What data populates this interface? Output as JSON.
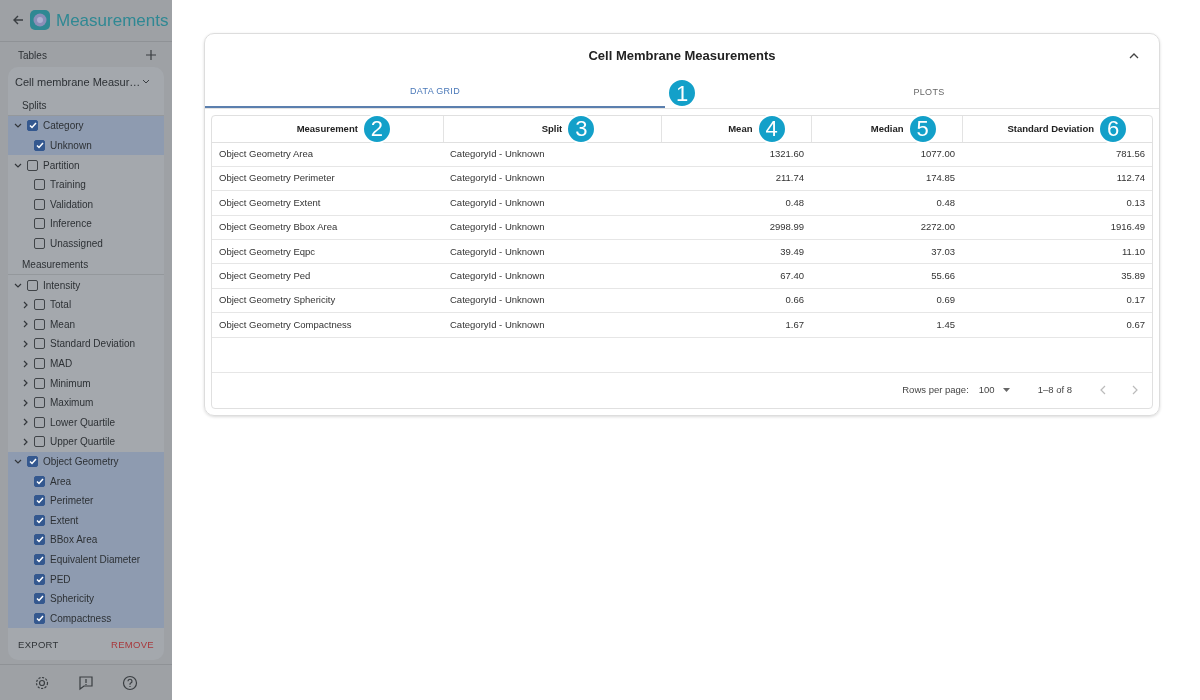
{
  "sidebar": {
    "title": "Measurements",
    "tables_label": "Tables",
    "table_select": "Cell membrane Measur…",
    "sections": [
      {
        "heading": "Splits",
        "items": [
          {
            "label": "Category",
            "checked": true,
            "expanded": true,
            "children": [
              {
                "label": "Unknown",
                "checked": true
              }
            ]
          },
          {
            "label": "Partition",
            "checked": false,
            "expanded": true,
            "children": [
              {
                "label": "Training",
                "checked": false
              },
              {
                "label": "Validation",
                "checked": false
              },
              {
                "label": "Inference",
                "checked": false
              },
              {
                "label": "Unassigned",
                "checked": false
              }
            ]
          }
        ]
      },
      {
        "heading": "Measurements",
        "items": [
          {
            "label": "Intensity",
            "checked": false,
            "expanded": true,
            "children": [
              {
                "label": "Total",
                "checked": false,
                "expanded": false
              },
              {
                "label": "Mean",
                "checked": false,
                "expanded": false
              },
              {
                "label": "Standard Deviation",
                "checked": false,
                "expanded": false
              },
              {
                "label": "MAD",
                "checked": false,
                "expanded": false
              },
              {
                "label": "Minimum",
                "checked": false,
                "expanded": false
              },
              {
                "label": "Maximum",
                "checked": false,
                "expanded": false
              },
              {
                "label": "Lower Quartile",
                "checked": false,
                "expanded": false
              },
              {
                "label": "Upper Quartile",
                "checked": false,
                "expanded": false
              }
            ]
          },
          {
            "label": "Object Geometry",
            "checked": true,
            "expanded": true,
            "children": [
              {
                "label": "Area",
                "checked": true
              },
              {
                "label": "Perimeter",
                "checked": true
              },
              {
                "label": "Extent",
                "checked": true
              },
              {
                "label": "BBox Area",
                "checked": true
              },
              {
                "label": "Equivalent Diameter",
                "checked": true
              },
              {
                "label": "PED",
                "checked": true
              },
              {
                "label": "Sphericity",
                "checked": true
              },
              {
                "label": "Compactness",
                "checked": true
              }
            ]
          }
        ]
      }
    ],
    "actions": [
      {
        "label": "EXPORT",
        "kind": "neutral"
      },
      {
        "label": "REMOVE",
        "kind": "danger"
      }
    ]
  },
  "card": {
    "title": "Cell Membrane Measurements"
  },
  "tabs": [
    {
      "label": "DATA GRID",
      "selected": true,
      "callout": "1"
    },
    {
      "label": "PLOTS",
      "selected": false
    }
  ],
  "grid": {
    "columns": [
      {
        "label": "Measurement",
        "kind": "text",
        "callout": "2"
      },
      {
        "label": "Split",
        "kind": "text",
        "callout": "3"
      },
      {
        "label": "Mean",
        "kind": "number",
        "callout": "4"
      },
      {
        "label": "Median",
        "kind": "number",
        "callout": "5"
      },
      {
        "label": "Standard Deviation",
        "kind": "number",
        "callout": "6"
      }
    ],
    "rows": [
      [
        "Object Geometry Area",
        "CategoryId - Unknown",
        "1321.60",
        "1077.00",
        "781.56"
      ],
      [
        "Object Geometry Perimeter",
        "CategoryId - Unknown",
        "211.74",
        "174.85",
        "112.74"
      ],
      [
        "Object Geometry Extent",
        "CategoryId - Unknown",
        "0.48",
        "0.48",
        "0.13"
      ],
      [
        "Object Geometry Bbox Area",
        "CategoryId - Unknown",
        "2998.99",
        "2272.00",
        "1916.49"
      ],
      [
        "Object Geometry Eqpc",
        "CategoryId - Unknown",
        "39.49",
        "37.03",
        "11.10"
      ],
      [
        "Object Geometry Ped",
        "CategoryId - Unknown",
        "67.40",
        "55.66",
        "35.89"
      ],
      [
        "Object Geometry Sphericity",
        "CategoryId - Unknown",
        "0.66",
        "0.69",
        "0.17"
      ],
      [
        "Object Geometry Compactness",
        "CategoryId - Unknown",
        "1.67",
        "1.45",
        "0.67"
      ]
    ],
    "footer": {
      "rows_per_page_label": "Rows per page:",
      "rows_per_page": "100",
      "range": "1–8 of 8"
    }
  }
}
